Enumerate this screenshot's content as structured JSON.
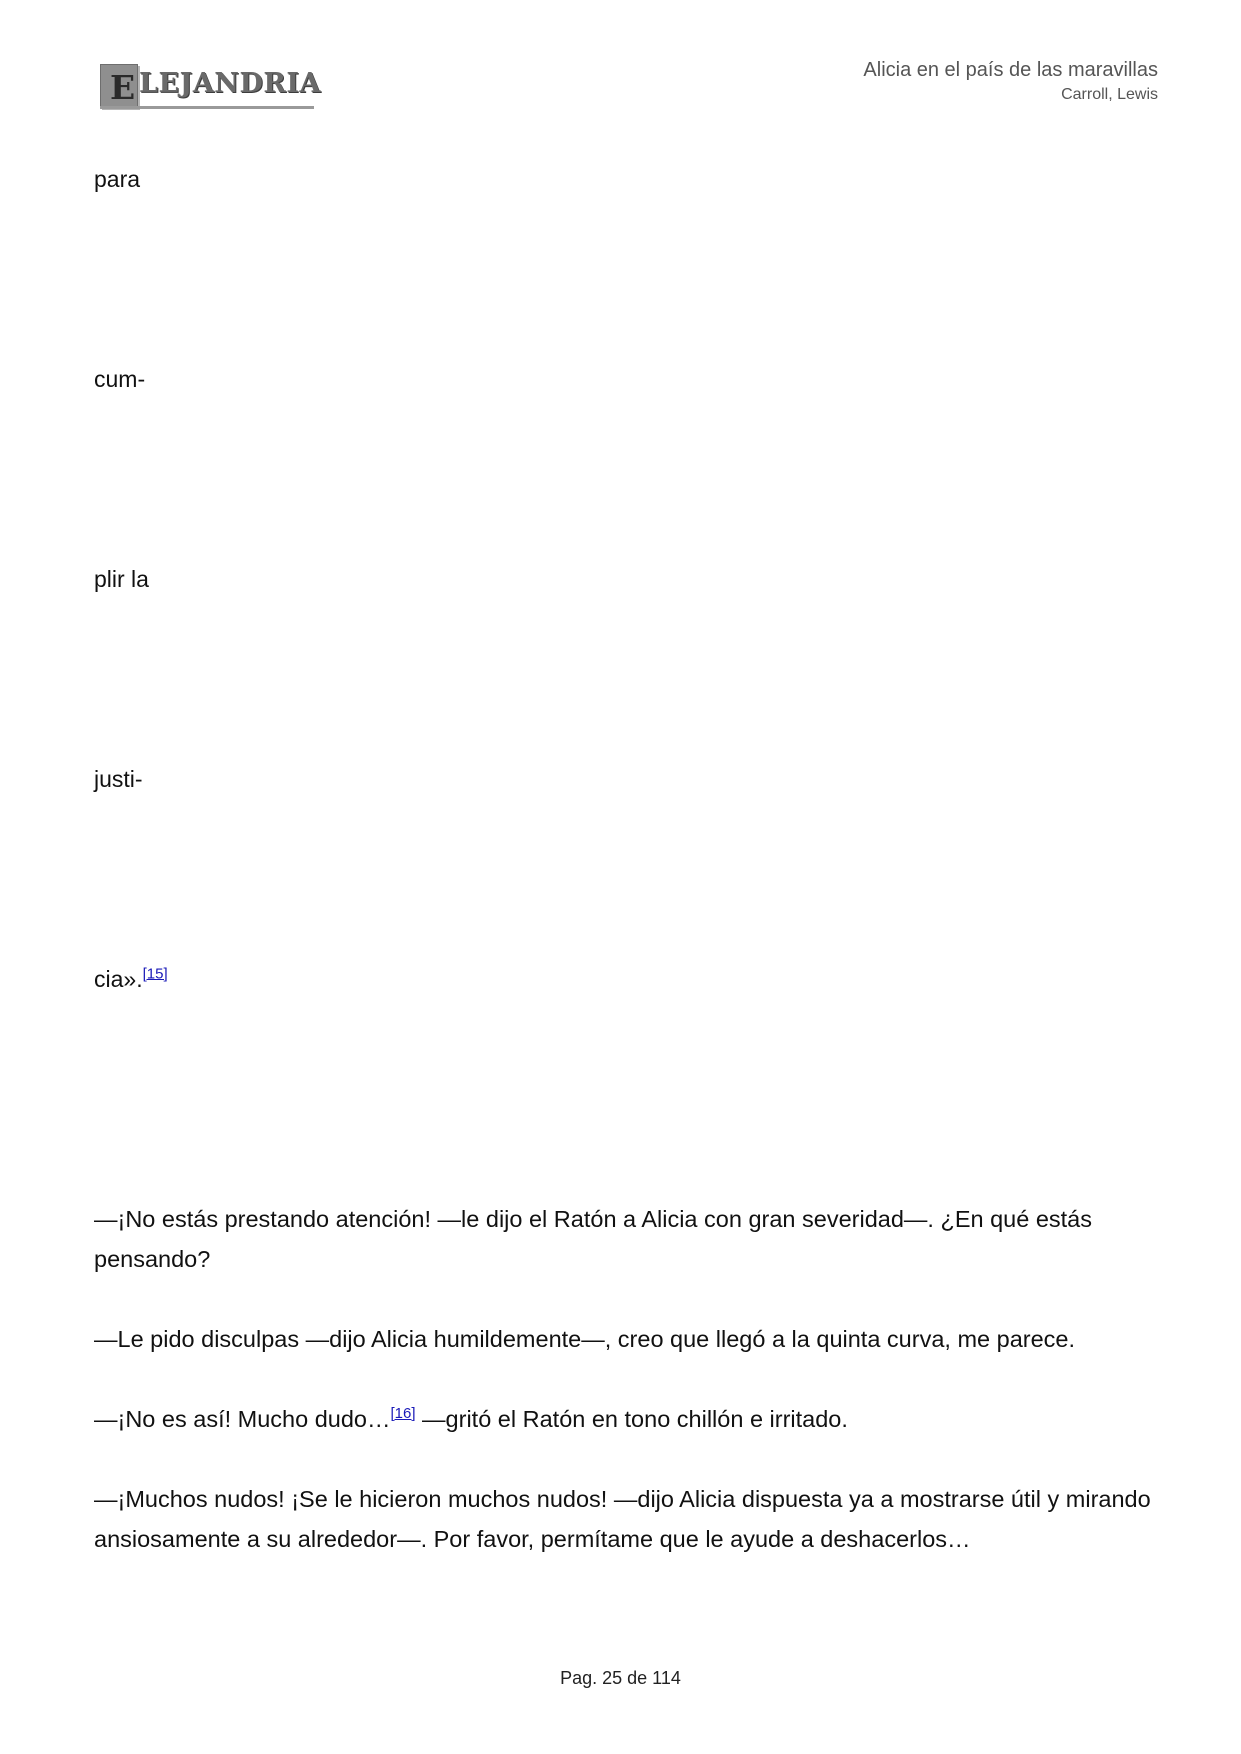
{
  "header": {
    "logo_letter": "E",
    "logo_word": "LEJANDRIA",
    "book_title": "Alicia en el país de las maravillas",
    "author": "Carroll, Lewis"
  },
  "poem": {
    "lines": [
      "para",
      "cum-",
      "plir la",
      "justi-",
      "cia»."
    ],
    "footnote": "[15]"
  },
  "paragraphs": [
    {
      "text": "—¡No estás prestando atención! —le dijo el Ratón a Alicia con gran severidad—. ¿En qué estás pensando?"
    },
    {
      "text": "—Le pido disculpas —dijo Alicia humildemente—, creo que llegó a la quinta curva, me parece."
    },
    {
      "before": "—¡No es así! Mucho dudo…",
      "footnote": "[16]",
      "after": " —gritó el Ratón en tono chillón e irritado."
    },
    {
      "text": "—¡Muchos nudos! ¡Se le hicieron muchos nudos! —dijo Alicia dispuesta ya a mostrarse útil y mirando ansiosamente a su alrededor—. Por favor, permítame que le ayude a deshacerlos…"
    }
  ],
  "footer": {
    "page_label": "Pag. 25 de 114"
  }
}
